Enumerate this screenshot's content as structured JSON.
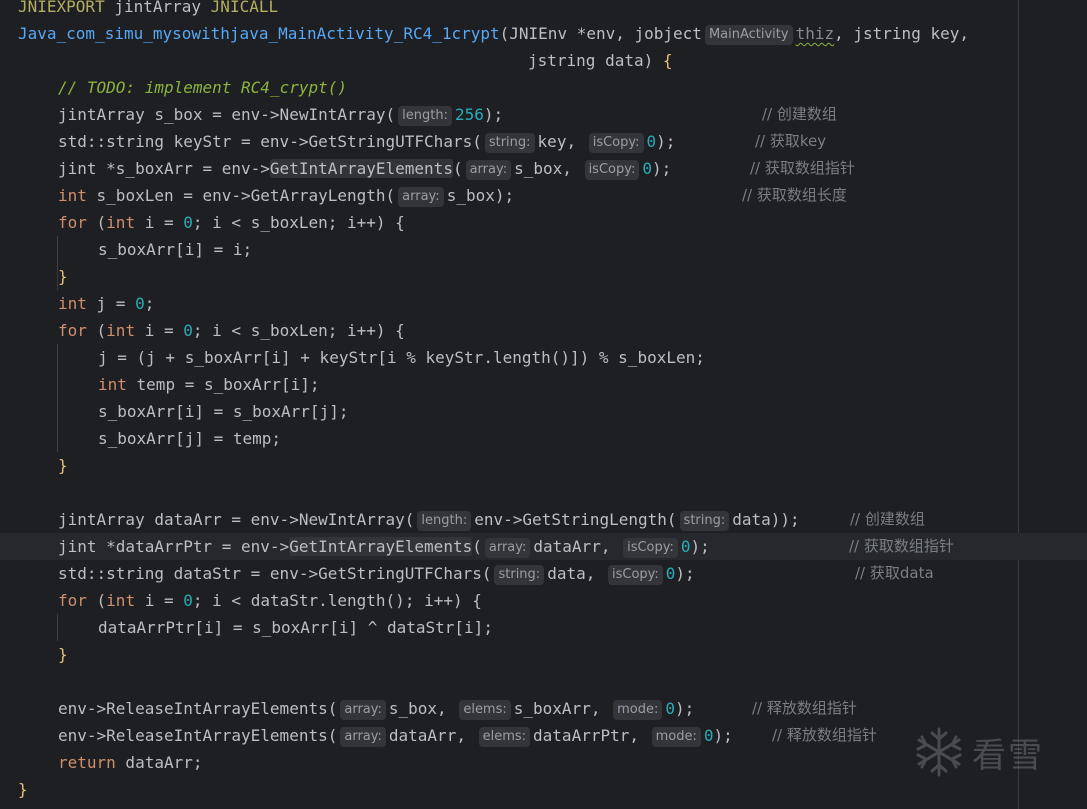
{
  "code": {
    "l0": {
      "a": "JNIEXPORT",
      "b": " jintArray ",
      "c": "JNICALL"
    },
    "l1": {
      "fn": "Java_com_simu_mysowithjava_MainActivity_RC4_1crypt",
      "a": "(JNIEnv *env, jobject",
      "hint": "MainActivity",
      "thiz": "thiz",
      "b": ", jstring key,"
    },
    "l2": {
      "a": "jstring data) ",
      "brace": "{"
    },
    "l3": {
      "cmt": "// ",
      "todo": "TODO: implement RC4_crypt()"
    },
    "l4": {
      "a": "jintArray s_box = env->NewIntArray(",
      "hint": "length:",
      "num": "256",
      "b": ");",
      "cmt": "// 创建数组"
    },
    "l5": {
      "a": "std::string keyStr = env->GetStringUTFChars(",
      "hint1": "string:",
      "b": "key, ",
      "hint2": "isCopy:",
      "num": "0",
      "c": ");",
      "cmt": "// 获取key"
    },
    "l6": {
      "a": "jint *s_boxArr = env->",
      "fn": "GetIntArrayElements",
      "b": "(",
      "hint1": "array:",
      "c": "s_box, ",
      "hint2": "isCopy:",
      "num": "0",
      "d": ");",
      "cmt": "// 获取数组指针"
    },
    "l7": {
      "kw": "int",
      "a": " s_boxLen = env->GetArrayLength(",
      "hint": "array:",
      "b": "s_box);",
      "cmt": "// 获取数组长度"
    },
    "l8": {
      "kw1": "for",
      "a": " (",
      "kw2": "int",
      "b": " i = ",
      "num": "0",
      "c": "; i < s_boxLen; i++) {"
    },
    "l9": {
      "a": "s_boxArr[i] = i;"
    },
    "l10": {
      "a": "}"
    },
    "l11": {
      "kw": "int",
      "a": " j = ",
      "num": "0",
      "b": ";"
    },
    "l12": {
      "kw1": "for",
      "a": " (",
      "kw2": "int",
      "b": " i = ",
      "num": "0",
      "c": "; i < s_boxLen; i++) {"
    },
    "l13": {
      "a": "j = (j + s_boxArr[i] + keyStr[i % keyStr.length()]) % s_boxLen;"
    },
    "l14": {
      "kw": "int",
      "a": " temp = s_boxArr[i];"
    },
    "l15": {
      "a": "s_boxArr[i] = s_boxArr[j];"
    },
    "l16": {
      "a": "s_boxArr[j] = temp;"
    },
    "l17": {
      "a": "}"
    },
    "l19": {
      "a": "jintArray dataArr = env->NewIntArray(",
      "hint1": "length:",
      "b": "env->GetStringLength(",
      "hint2": "string:",
      "c": "data));",
      "cmt": "// 创建数组"
    },
    "l20": {
      "a": "jint *dataArrPtr = env->",
      "fn": "GetIntArrayElements",
      "b": "(",
      "hint1": "array:",
      "c": "dataArr, ",
      "hint2": "isCopy:",
      "num": "0",
      "d": ");",
      "cmt": "// 获取数组指针"
    },
    "l21": {
      "a": "std::string dataStr = env->GetStringUTFChars(",
      "hint1": "string:",
      "b": "data, ",
      "hint2": "isCopy:",
      "num": "0",
      "c": ");",
      "cmt": "// 获取data"
    },
    "l22": {
      "kw1": "for",
      "a": " (",
      "kw2": "int",
      "b": " i = ",
      "num": "0",
      "c": "; i < dataStr.length(); i++) {"
    },
    "l23": {
      "a": "dataArrPtr[i] = s_boxArr[i] ^ dataStr[i];"
    },
    "l24": {
      "a": "}"
    },
    "l26": {
      "a": "env->ReleaseIntArrayElements(",
      "hint1": "array:",
      "b": "s_box, ",
      "hint2": "elems:",
      "c": "s_boxArr, ",
      "hint3": "mode:",
      "num": "0",
      "d": ");",
      "cmt": "// 释放数组指针"
    },
    "l27": {
      "a": "env->ReleaseIntArrayElements(",
      "hint1": "array:",
      "b": "dataArr, ",
      "hint2": "elems:",
      "c": "dataArrPtr, ",
      "hint3": "mode:",
      "num": "0",
      "d": ");",
      "cmt": "// 释放数组指针"
    },
    "l28": {
      "kw": "return",
      "a": " dataArr;"
    },
    "l29": {
      "a": "}"
    }
  },
  "watermark": {
    "text": "看雪",
    "icon": "snowflake-icon"
  },
  "colors": {
    "background": "#1e1f22",
    "keyword": "#cf8e6d",
    "function": "#56a8f5",
    "number": "#2aacb8",
    "comment": "#7a7e85",
    "macro": "#b3ae60"
  }
}
